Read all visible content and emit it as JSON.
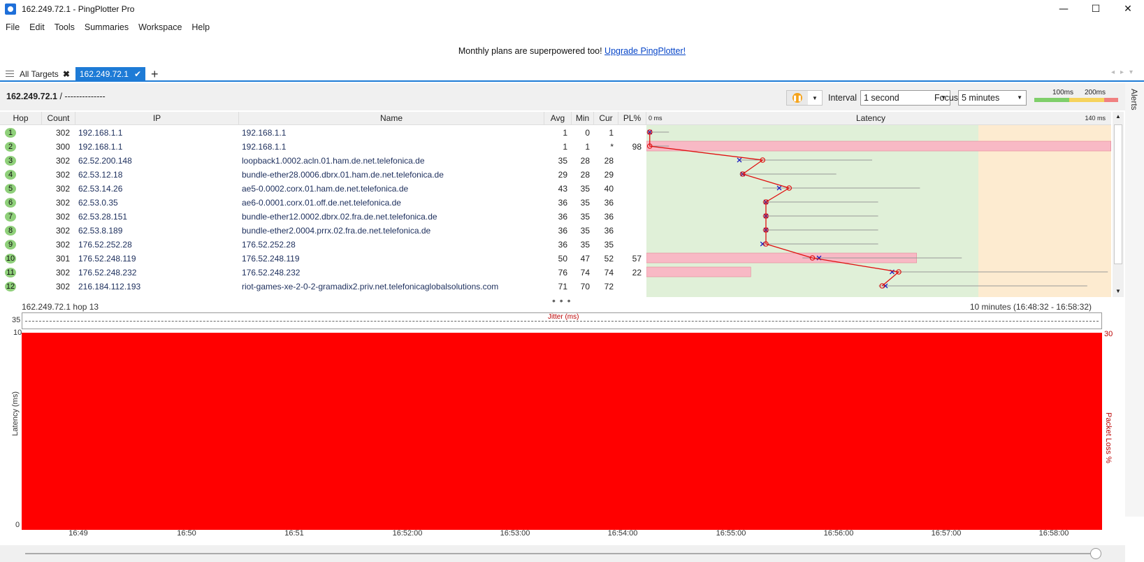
{
  "window": {
    "title": "162.249.72.1 - PingPlotter Pro",
    "minimize": "—",
    "maximize": "☐",
    "close": "✕"
  },
  "menu": [
    "File",
    "Edit",
    "Tools",
    "Summaries",
    "Workspace",
    "Help"
  ],
  "promo": {
    "text": "Monthly plans are superpowered too! ",
    "link": "Upgrade PingPlotter!"
  },
  "tabs": {
    "all_targets": "All Targets",
    "active": "162.249.72.1",
    "add": "+"
  },
  "breadcrumb": {
    "target": "162.249.72.1",
    "sep": " / ",
    "name": "--------------"
  },
  "controls": {
    "interval_label": "Interval",
    "interval_value": "1 second",
    "focus_label": "Focus",
    "focus_value": "5 minutes",
    "legend_100": "100ms",
    "legend_200": "200ms"
  },
  "alerts_label": "Alerts",
  "table": {
    "headers": [
      "Hop",
      "Count",
      "IP",
      "Name",
      "Avg",
      "Min",
      "Cur",
      "PL%"
    ],
    "latency_header": "Latency",
    "latency_min": "0 ms",
    "latency_max": "140 ms",
    "rows": [
      {
        "hop": "1",
        "count": "302",
        "ip": "192.168.1.1",
        "name": "192.168.1.1",
        "avg": "1",
        "min": "0",
        "cur": "1",
        "pl": ""
      },
      {
        "hop": "2",
        "count": "300",
        "ip": "192.168.1.1",
        "name": "192.168.1.1",
        "avg": "1",
        "min": "1",
        "cur": "*",
        "pl": "98"
      },
      {
        "hop": "3",
        "count": "302",
        "ip": "62.52.200.148",
        "name": "loopback1.0002.acln.01.ham.de.net.telefonica.de",
        "avg": "35",
        "min": "28",
        "cur": "28",
        "pl": ""
      },
      {
        "hop": "4",
        "count": "302",
        "ip": "62.53.12.18",
        "name": "bundle-ether28.0006.dbrx.01.ham.de.net.telefonica.de",
        "avg": "29",
        "min": "28",
        "cur": "29",
        "pl": ""
      },
      {
        "hop": "5",
        "count": "302",
        "ip": "62.53.14.26",
        "name": "ae5-0.0002.corx.01.ham.de.net.telefonica.de",
        "avg": "43",
        "min": "35",
        "cur": "40",
        "pl": ""
      },
      {
        "hop": "6",
        "count": "302",
        "ip": "62.53.0.35",
        "name": "ae6-0.0001.corx.01.off.de.net.telefonica.de",
        "avg": "36",
        "min": "35",
        "cur": "36",
        "pl": ""
      },
      {
        "hop": "7",
        "count": "302",
        "ip": "62.53.28.151",
        "name": "bundle-ether12.0002.dbrx.02.fra.de.net.telefonica.de",
        "avg": "36",
        "min": "35",
        "cur": "36",
        "pl": ""
      },
      {
        "hop": "8",
        "count": "302",
        "ip": "62.53.8.189",
        "name": "bundle-ether2.0004.prrx.02.fra.de.net.telefonica.de",
        "avg": "36",
        "min": "35",
        "cur": "36",
        "pl": ""
      },
      {
        "hop": "9",
        "count": "302",
        "ip": "176.52.252.28",
        "name": "176.52.252.28",
        "avg": "36",
        "min": "35",
        "cur": "35",
        "pl": ""
      },
      {
        "hop": "10",
        "count": "301",
        "ip": "176.52.248.119",
        "name": "176.52.248.119",
        "avg": "50",
        "min": "47",
        "cur": "52",
        "pl": "57"
      },
      {
        "hop": "11",
        "count": "302",
        "ip": "176.52.248.232",
        "name": "176.52.248.232",
        "avg": "76",
        "min": "74",
        "cur": "74",
        "pl": "22"
      },
      {
        "hop": "12",
        "count": "302",
        "ip": "216.184.112.193",
        "name": "riot-games-xe-2-0-2-gramadix2.priv.net.telefonicaglobalsolutions.com",
        "avg": "71",
        "min": "70",
        "cur": "72",
        "pl": ""
      }
    ]
  },
  "bottom": {
    "title": "162.249.72.1 hop 13",
    "range": "10 minutes (16:48:32 - 16:58:32)",
    "jitter_label": "Jitter (ms)",
    "jitter_max": "35",
    "ymax": "10",
    "ymin": "0",
    "pl_max": "30",
    "ylabel": "Latency (ms)",
    "ylabel_right": "Packet Loss %",
    "x_ticks": [
      "16:49",
      "16:50",
      "16:51",
      "16:52:00",
      "16:53:00",
      "16:54:00",
      "16:55:00",
      "16:56:00",
      "16:57:00",
      "16:58:00"
    ]
  }
}
